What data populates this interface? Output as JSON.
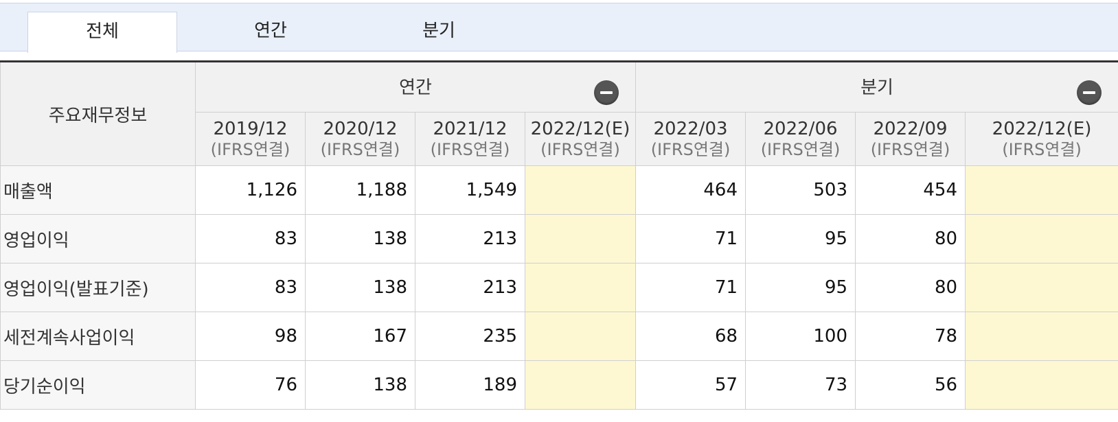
{
  "tabs": [
    {
      "label": "전체",
      "active": true
    },
    {
      "label": "연간",
      "active": false
    },
    {
      "label": "분기",
      "active": false
    }
  ],
  "table": {
    "row_header": "주요재무정보",
    "groups": [
      {
        "label": "연간"
      },
      {
        "label": "분기"
      }
    ],
    "periods": [
      {
        "date": "2019/12",
        "type": "(IFRS연결)"
      },
      {
        "date": "2020/12",
        "type": "(IFRS연결)"
      },
      {
        "date": "2021/12",
        "type": "(IFRS연결)"
      },
      {
        "date": "2022/12(E)",
        "type": "(IFRS연결)"
      },
      {
        "date": "2022/03",
        "type": "(IFRS연결)"
      },
      {
        "date": "2022/06",
        "type": "(IFRS연결)"
      },
      {
        "date": "2022/09",
        "type": "(IFRS연결)"
      },
      {
        "date": "2022/12(E)",
        "type": "(IFRS연결)"
      }
    ],
    "rows": [
      {
        "label": "매출액",
        "values": [
          "1,126",
          "1,188",
          "1,549",
          "",
          "464",
          "503",
          "454",
          ""
        ]
      },
      {
        "label": "영업이익",
        "values": [
          "83",
          "138",
          "213",
          "",
          "71",
          "95",
          "80",
          ""
        ]
      },
      {
        "label": "영업이익(발표기준)",
        "values": [
          "83",
          "138",
          "213",
          "",
          "71",
          "95",
          "80",
          ""
        ]
      },
      {
        "label": "세전계속사업이익",
        "values": [
          "98",
          "167",
          "235",
          "",
          "68",
          "100",
          "78",
          ""
        ]
      },
      {
        "label": "당기순이익",
        "values": [
          "76",
          "138",
          "189",
          "",
          "57",
          "73",
          "56",
          ""
        ]
      }
    ]
  },
  "colors": {
    "tabbar_bg": "#e9f0fa",
    "header_bg": "#f1f1f1",
    "estimate_bg": "#fdf8d2",
    "top_border": "#333333"
  },
  "icons": {
    "collapse": "minus-circle-icon"
  }
}
